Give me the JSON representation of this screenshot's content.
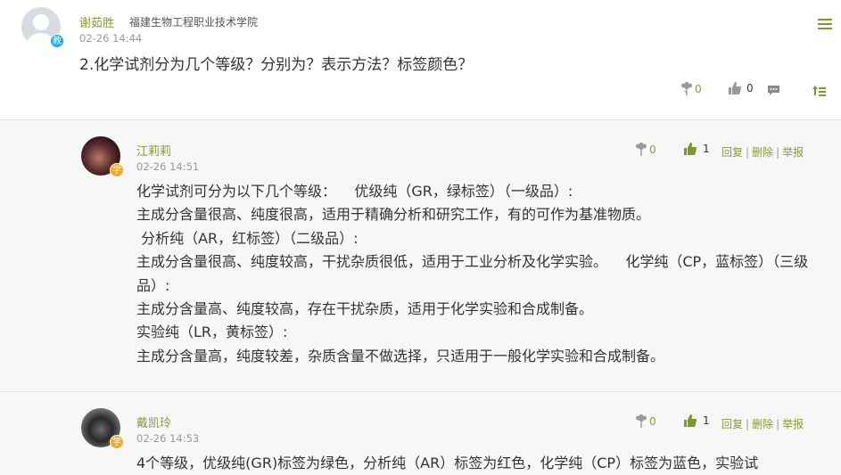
{
  "post": {
    "author": "谢茹胜",
    "role_badge": "教",
    "school": "福建生物工程职业技术学院",
    "time": "02-26 14:44",
    "question": "2.化学试剂分为几个等级？分别为？表示方法？标签颜色？",
    "flower_count": "0",
    "like_count": "0"
  },
  "replies": [
    {
      "author": "江莉莉",
      "role_badge": "学",
      "time": "02-26 14:51",
      "flower_count": "0",
      "like_count": "1",
      "reply_label": "回复",
      "delete_label": "删除",
      "report_label": "举报",
      "text": "化学试剂可分为以下几个等级：    优级纯（GR，绿标签）（一级品）:\n主成分含量很高、纯度很高，适用于精确分析和研究工作，有的可作为基准物质。\n 分析纯（AR，红标签）（二级品）:\n主成分含量很高、纯度较高，干扰杂质很低，适用于工业分析及化学实验。    化学纯（CP，蓝标签）（三级品）:\n主成分含量高、纯度较高，存在干扰杂质，适用于化学实验和合成制备。\n实验纯（LR，黄标签）:\n主成分含量高，纯度较差，杂质含量不做选择，只适用于一般化学实验和合成制备。"
    },
    {
      "author": "戴凯玲",
      "role_badge": "学",
      "time": "02-26 14:53",
      "flower_count": "0",
      "like_count": "1",
      "reply_label": "回复",
      "delete_label": "删除",
      "report_label": "举报",
      "text": "4个等级，优级纯(GR)标签为绿色，分析纯（AR）标签为红色，化学纯（CP）标签为蓝色，实验试"
    }
  ],
  "colors": {
    "accent_green": "#7a9a2a",
    "teacher_badge": "#29a9e0",
    "student_badge": "#f5a623"
  }
}
